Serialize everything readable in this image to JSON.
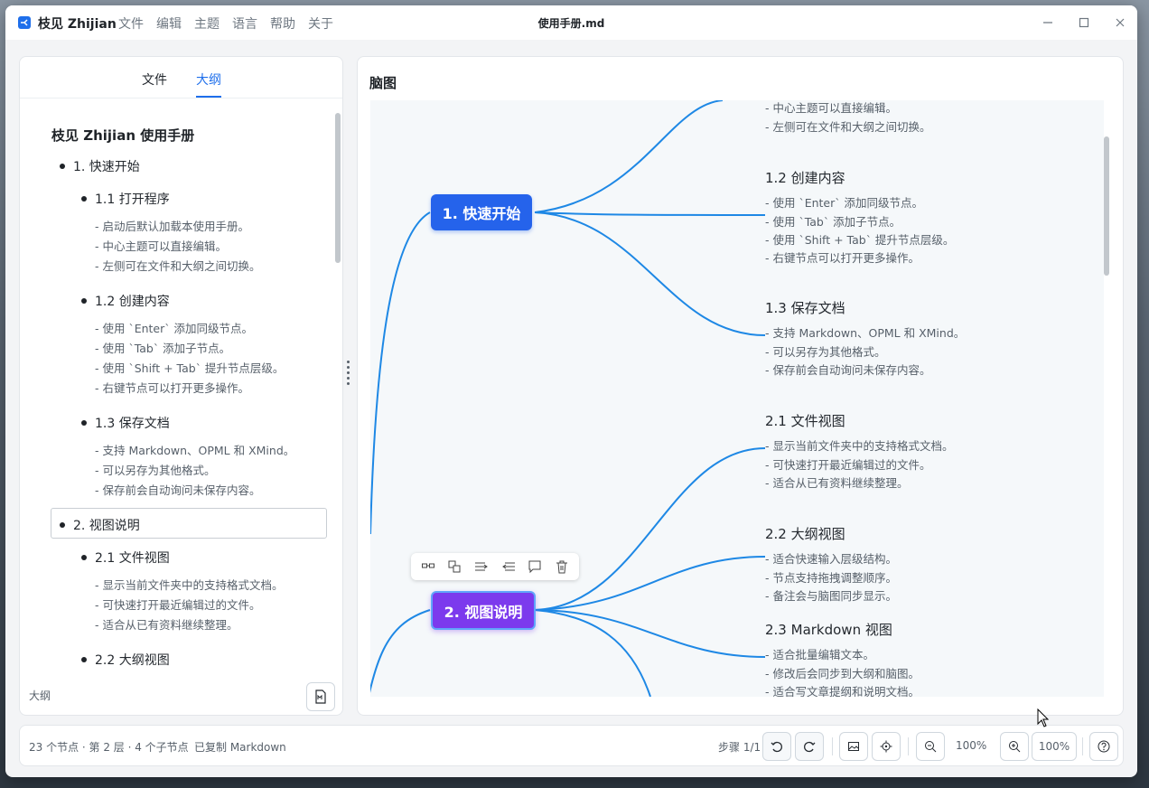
{
  "app": {
    "name": "枝见 Zhijian",
    "document_title": "使用手册.md"
  },
  "menu": [
    "文件",
    "编辑",
    "主题",
    "语言",
    "帮助",
    "关于"
  ],
  "sidebar": {
    "tabs": [
      {
        "label": "文件",
        "active": false
      },
      {
        "label": "大纲",
        "active": true
      }
    ],
    "outline_title": "枝见 Zhijian 使用手册",
    "sections": [
      {
        "label": "1. 快速开始",
        "children": [
          {
            "label": "1.1 打开程序",
            "notes": [
              "- 启动后默认加载本使用手册。",
              "- 中心主题可以直接编辑。",
              "- 左侧可在文件和大纲之间切换。"
            ]
          },
          {
            "label": "1.2 创建内容",
            "notes": [
              "- 使用 `Enter` 添加同级节点。",
              "- 使用 `Tab` 添加子节点。",
              "- 使用 `Shift + Tab` 提升节点层级。",
              "- 右键节点可以打开更多操作。"
            ]
          },
          {
            "label": "1.3 保存文档",
            "notes": [
              "- 支持 Markdown、OPML 和 XMind。",
              "- 可以另存为其他格式。",
              "- 保存前会自动询问未保存内容。"
            ]
          }
        ]
      },
      {
        "label": "2. 视图说明",
        "selected": true,
        "children": [
          {
            "label": "2.1 文件视图",
            "notes": [
              "- 显示当前文件夹中的支持格式文档。",
              "- 可快速打开最近编辑过的文件。",
              "- 适合从已有资料继续整理。"
            ]
          },
          {
            "label": "2.2 大纲视图",
            "notes": []
          }
        ]
      }
    ],
    "footer_label": "大纲"
  },
  "mindmap": {
    "title": "脑图",
    "topics": [
      {
        "label": "1. 快速开始",
        "color": "#2563eb"
      },
      {
        "label": "2. 视图说明",
        "color": "#7c3aed",
        "selected": true
      }
    ],
    "branches": [
      {
        "label": "",
        "notes": [
          "- 中心主题可以直接编辑。",
          "- 左侧可在文件和大纲之间切换。"
        ]
      },
      {
        "label": "1.2 创建内容",
        "notes": [
          "- 使用 `Enter` 添加同级节点。",
          "- 使用 `Tab` 添加子节点。",
          "- 使用 `Shift + Tab` 提升节点层级。",
          "- 右键节点可以打开更多操作。"
        ]
      },
      {
        "label": "1.3 保存文档",
        "notes": [
          "- 支持 Markdown、OPML 和 XMind。",
          "- 可以另存为其他格式。",
          "- 保存前会自动询问未保存内容。"
        ]
      },
      {
        "label": "2.1 文件视图",
        "notes": [
          "- 显示当前文件夹中的支持格式文档。",
          "- 可快速打开最近编辑过的文件。",
          "- 适合从已有资料继续整理。"
        ]
      },
      {
        "label": "2.2 大纲视图",
        "notes": [
          "- 适合快速输入层级结构。",
          "- 节点支持拖拽调整顺序。",
          "- 备注会与脑图同步显示。"
        ]
      },
      {
        "label": "2.3 Markdown 视图",
        "notes": [
          "- 适合批量编辑文本。",
          "- 修改后会同步到大纲和脑图。",
          "- 适合写文章提纲和说明文档。"
        ]
      }
    ],
    "toolbar_icons": [
      "link-nodes-icon",
      "add-child-icon",
      "indent-icon",
      "outdent-icon",
      "comment-icon",
      "trash-icon"
    ],
    "accent": "#1e88e5"
  },
  "status": {
    "info": "23 个节点 · 第 2 层 · 4 个子节点",
    "message": "已复制 Markdown",
    "step": "步骤 1/1",
    "zoom_value": "100%",
    "zoom_box": "100%"
  }
}
